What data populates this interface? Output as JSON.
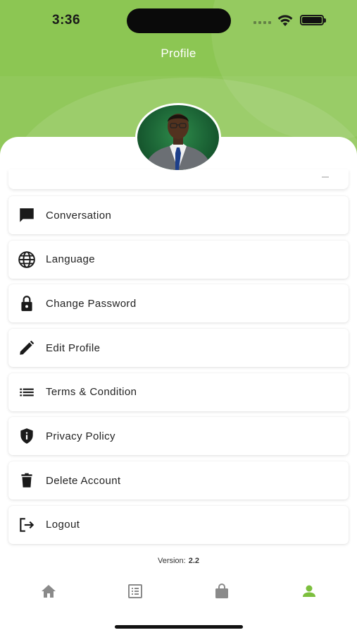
{
  "status_bar": {
    "time": "3:36"
  },
  "header": {
    "title": "Profile"
  },
  "menu": {
    "items": [
      {
        "label": "Conversation",
        "icon": "chat-icon"
      },
      {
        "label": "Language",
        "icon": "globe-icon"
      },
      {
        "label": "Change Password",
        "icon": "lock-icon"
      },
      {
        "label": "Edit Profile",
        "icon": "pencil-icon"
      },
      {
        "label": "Terms & Condition",
        "icon": "list-icon"
      },
      {
        "label": "Privacy Policy",
        "icon": "shield-icon"
      },
      {
        "label": "Delete Account",
        "icon": "trash-icon"
      },
      {
        "label": "Logout",
        "icon": "logout-icon"
      }
    ]
  },
  "version": {
    "label": "Version:",
    "value": "2.2"
  },
  "bottom_nav": {
    "items": [
      {
        "icon": "home-icon",
        "active": false
      },
      {
        "icon": "list-alt-icon",
        "active": false
      },
      {
        "icon": "shopping-bag-icon",
        "active": false
      },
      {
        "icon": "person-icon",
        "active": true
      }
    ]
  },
  "colors": {
    "accent": "#8cc653",
    "nav_inactive": "#8a8a8a",
    "nav_active": "#7cbf3d"
  }
}
